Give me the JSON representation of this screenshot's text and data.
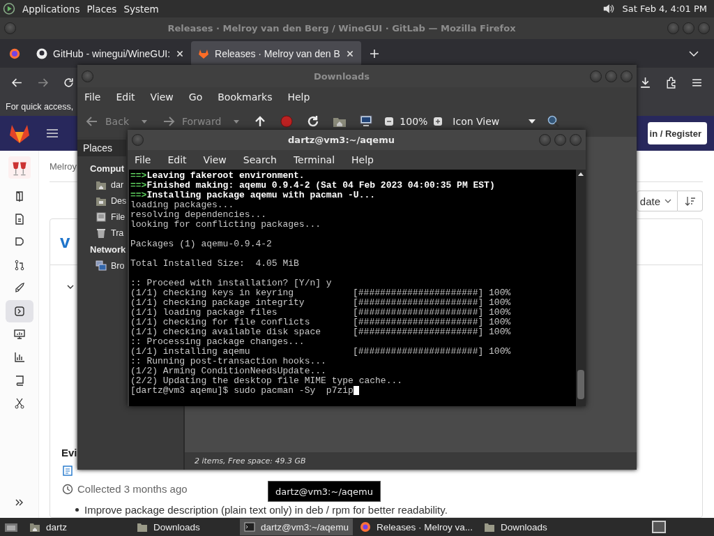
{
  "top_panel": {
    "menus": [
      "Applications",
      "Places",
      "System"
    ],
    "clock": "Sat Feb 4, 4:01 PM"
  },
  "firefox": {
    "title": "Releases · Melroy van den Berg / WineGUI · GitLab — Mozilla Firefox",
    "tabs": [
      {
        "label": "GitHub - winegui/WineGUI:",
        "kind": "github",
        "selected": false
      },
      {
        "label": "Releases · Melroy van den B",
        "kind": "gitlab",
        "selected": true
      }
    ],
    "bookmarks_hint": "For quick access,",
    "gitlab": {
      "sign_in": "in / Register",
      "nav": [
        {
          "kind": "project",
          "selected": false
        },
        {
          "kind": "repository",
          "selected": false
        },
        {
          "kind": "issues",
          "selected": false
        },
        {
          "kind": "merge",
          "selected": false
        },
        {
          "kind": "cicd",
          "selected": false
        },
        {
          "kind": "deploy",
          "selected": true
        },
        {
          "kind": "monitor",
          "selected": false
        },
        {
          "kind": "analytics",
          "selected": false
        },
        {
          "kind": "wiki",
          "selected": false
        },
        {
          "kind": "snippets",
          "selected": false
        }
      ],
      "breadcrumb": "Melroy",
      "sort_label": "date",
      "release_title": "v",
      "evidence_heading": "Evi",
      "collected": "Collected 3 months ago",
      "notes": [
        "Improve package description (plain text only) in deb / rpm for better readability."
      ]
    }
  },
  "downloads": {
    "title": "Downloads",
    "menu": [
      "File",
      "Edit",
      "View",
      "Go",
      "Bookmarks",
      "Help"
    ],
    "nav_buttons": [
      {
        "label": "Back",
        "kind": "back",
        "disabled": true
      },
      {
        "label": "Forward",
        "kind": "forward",
        "disabled": true
      }
    ],
    "zoom": "100%",
    "view": "Icon View",
    "places_header": "Places",
    "sections": [
      {
        "title": "Comput",
        "items": [
          {
            "label": "dar",
            "kind": "home"
          },
          {
            "label": "Des",
            "kind": "desktop"
          },
          {
            "label": "File",
            "kind": "filesystem"
          },
          {
            "label": "Tra",
            "kind": "trash"
          }
        ]
      },
      {
        "title": "Network",
        "items": [
          {
            "label": "Bro",
            "kind": "network"
          }
        ]
      }
    ],
    "status": "2 items, Free space: 49.3 GB"
  },
  "terminal": {
    "title": "dartz@vm3:~/aqemu",
    "menu": [
      "File",
      "Edit",
      "View",
      "Search",
      "Terminal",
      "Help"
    ],
    "blocks": [
      [
        {
          "kind": "step",
          "marker": "==>",
          "text": "Leaving fakeroot environment."
        },
        {
          "kind": "step",
          "marker": "==>",
          "text": "Finished making: aqemu 0.9.4-2 (Sat 04 Feb 2023 04:00:35 PM EST)"
        },
        {
          "kind": "step",
          "marker": "==>",
          "text": "Installing package aqemu with pacman -U..."
        },
        {
          "kind": "plain",
          "text": "loading packages..."
        },
        {
          "kind": "plain",
          "text": "resolving dependencies..."
        },
        {
          "kind": "plain",
          "text": "looking for conflicting packages..."
        }
      ],
      [
        {
          "kind": "plain",
          "text": "Packages (1) aqemu-0.9.4-2"
        }
      ],
      [
        {
          "kind": "plain",
          "text": "Total Installed Size:  4.05 MiB"
        }
      ],
      [
        {
          "kind": "plain",
          "text": ":: Proceed with installation? [Y/n] y"
        },
        {
          "kind": "progress",
          "text": "(1/1) checking keys in keyring",
          "bar": "[######################]",
          "percent": "100%"
        },
        {
          "kind": "progress",
          "text": "(1/1) checking package integrity",
          "bar": "[######################]",
          "percent": "100%"
        },
        {
          "kind": "progress",
          "text": "(1/1) loading package files",
          "bar": "[######################]",
          "percent": "100%"
        },
        {
          "kind": "progress",
          "text": "(1/1) checking for file conflicts",
          "bar": "[######################]",
          "percent": "100%"
        },
        {
          "kind": "progress",
          "text": "(1/1) checking available disk space",
          "bar": "[######################]",
          "percent": "100%"
        },
        {
          "kind": "plain",
          "text": ":: Processing package changes..."
        },
        {
          "kind": "progress",
          "text": "(1/1) installing aqemu",
          "bar": "[######################]",
          "percent": "100%"
        },
        {
          "kind": "plain",
          "text": ":: Running post-transaction hooks..."
        },
        {
          "kind": "plain",
          "text": "(1/2) Arming ConditionNeedsUpdate..."
        },
        {
          "kind": "plain",
          "text": "(2/2) Updating the desktop file MIME type cache..."
        },
        {
          "kind": "prompt",
          "text": "[dartz@vm3 aqemu]$ sudo pacman -Sy  p7zip"
        }
      ]
    ]
  },
  "tooltip": "dartz@vm3:~/aqemu",
  "taskbar": {
    "items": [
      {
        "label": "dartz",
        "kind": "home",
        "selected": false
      },
      {
        "label": "Downloads",
        "kind": "folder",
        "selected": false
      },
      {
        "label": "dartz@vm3:~/aqemu",
        "kind": "terminal",
        "selected": true
      },
      {
        "label": "Releases · Melroy va...",
        "kind": "browser",
        "selected": false
      },
      {
        "label": "Downloads",
        "kind": "folder",
        "selected": false
      }
    ]
  }
}
